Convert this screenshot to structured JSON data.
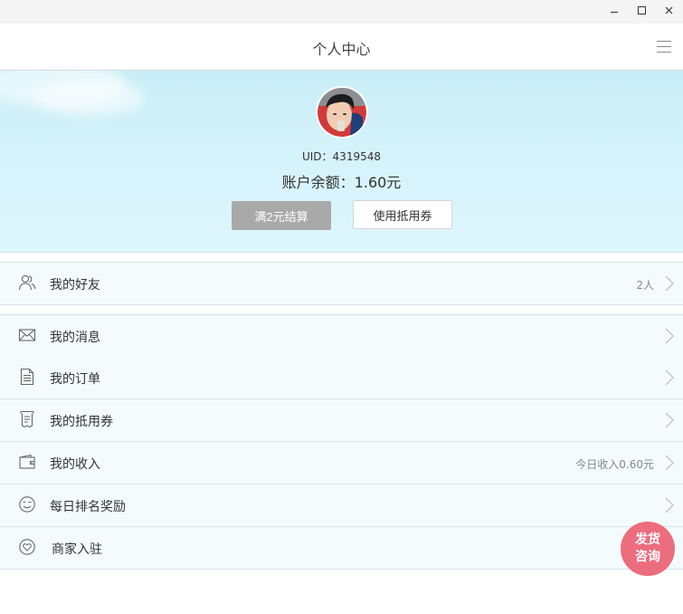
{
  "header": {
    "title": "个人中心"
  },
  "profile": {
    "uid_text": "UID：4319548",
    "balance_text": "账户余额：1.60元",
    "settle_button": "满2元结算",
    "voucher_button": "使用抵用券"
  },
  "menu": [
    {
      "label": "我的好友",
      "extra": "2人",
      "icon": "friends-icon"
    },
    {
      "label": "我的消息",
      "extra": "",
      "icon": "envelope-icon"
    },
    {
      "label": "我的订单",
      "extra": "",
      "icon": "document-icon"
    },
    {
      "label": "我的抵用券",
      "extra": "",
      "icon": "receipt-icon"
    },
    {
      "label": "我的收入",
      "extra": "今日收入0.60元",
      "icon": "wallet-icon"
    },
    {
      "label": "每日排名奖励",
      "extra": "",
      "icon": "smile-icon"
    },
    {
      "label": "商家入驻",
      "extra": "",
      "icon": "heart-icon"
    }
  ],
  "badge": {
    "line1": "发货",
    "line2": "咨询"
  },
  "colors": {
    "badge": "#ec6d7d",
    "settle_button": "#a9a9a9",
    "banner": "#c9eef7"
  }
}
